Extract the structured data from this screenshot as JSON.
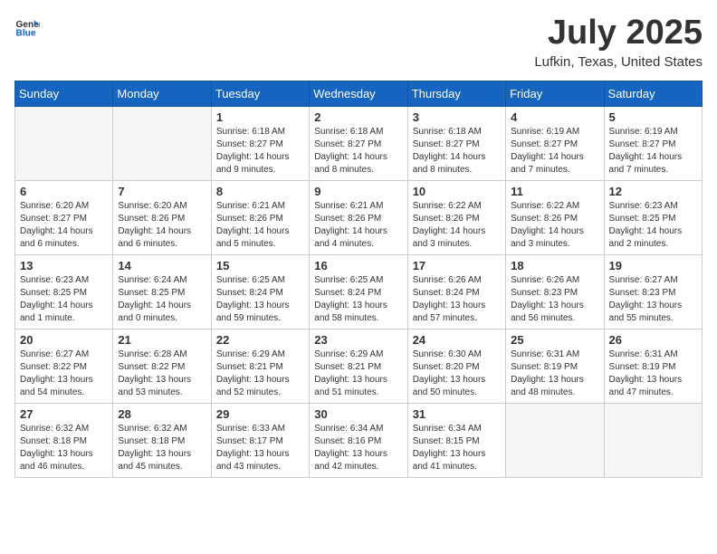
{
  "header": {
    "logo_general": "General",
    "logo_blue": "Blue",
    "month_year": "July 2025",
    "location": "Lufkin, Texas, United States"
  },
  "weekdays": [
    "Sunday",
    "Monday",
    "Tuesday",
    "Wednesday",
    "Thursday",
    "Friday",
    "Saturday"
  ],
  "weeks": [
    [
      {
        "day": "",
        "info": ""
      },
      {
        "day": "",
        "info": ""
      },
      {
        "day": "1",
        "info": "Sunrise: 6:18 AM\nSunset: 8:27 PM\nDaylight: 14 hours\nand 9 minutes."
      },
      {
        "day": "2",
        "info": "Sunrise: 6:18 AM\nSunset: 8:27 PM\nDaylight: 14 hours\nand 8 minutes."
      },
      {
        "day": "3",
        "info": "Sunrise: 6:18 AM\nSunset: 8:27 PM\nDaylight: 14 hours\nand 8 minutes."
      },
      {
        "day": "4",
        "info": "Sunrise: 6:19 AM\nSunset: 8:27 PM\nDaylight: 14 hours\nand 7 minutes."
      },
      {
        "day": "5",
        "info": "Sunrise: 6:19 AM\nSunset: 8:27 PM\nDaylight: 14 hours\nand 7 minutes."
      }
    ],
    [
      {
        "day": "6",
        "info": "Sunrise: 6:20 AM\nSunset: 8:27 PM\nDaylight: 14 hours\nand 6 minutes."
      },
      {
        "day": "7",
        "info": "Sunrise: 6:20 AM\nSunset: 8:26 PM\nDaylight: 14 hours\nand 6 minutes."
      },
      {
        "day": "8",
        "info": "Sunrise: 6:21 AM\nSunset: 8:26 PM\nDaylight: 14 hours\nand 5 minutes."
      },
      {
        "day": "9",
        "info": "Sunrise: 6:21 AM\nSunset: 8:26 PM\nDaylight: 14 hours\nand 4 minutes."
      },
      {
        "day": "10",
        "info": "Sunrise: 6:22 AM\nSunset: 8:26 PM\nDaylight: 14 hours\nand 3 minutes."
      },
      {
        "day": "11",
        "info": "Sunrise: 6:22 AM\nSunset: 8:26 PM\nDaylight: 14 hours\nand 3 minutes."
      },
      {
        "day": "12",
        "info": "Sunrise: 6:23 AM\nSunset: 8:25 PM\nDaylight: 14 hours\nand 2 minutes."
      }
    ],
    [
      {
        "day": "13",
        "info": "Sunrise: 6:23 AM\nSunset: 8:25 PM\nDaylight: 14 hours\nand 1 minute."
      },
      {
        "day": "14",
        "info": "Sunrise: 6:24 AM\nSunset: 8:25 PM\nDaylight: 14 hours\nand 0 minutes."
      },
      {
        "day": "15",
        "info": "Sunrise: 6:25 AM\nSunset: 8:24 PM\nDaylight: 13 hours\nand 59 minutes."
      },
      {
        "day": "16",
        "info": "Sunrise: 6:25 AM\nSunset: 8:24 PM\nDaylight: 13 hours\nand 58 minutes."
      },
      {
        "day": "17",
        "info": "Sunrise: 6:26 AM\nSunset: 8:24 PM\nDaylight: 13 hours\nand 57 minutes."
      },
      {
        "day": "18",
        "info": "Sunrise: 6:26 AM\nSunset: 8:23 PM\nDaylight: 13 hours\nand 56 minutes."
      },
      {
        "day": "19",
        "info": "Sunrise: 6:27 AM\nSunset: 8:23 PM\nDaylight: 13 hours\nand 55 minutes."
      }
    ],
    [
      {
        "day": "20",
        "info": "Sunrise: 6:27 AM\nSunset: 8:22 PM\nDaylight: 13 hours\nand 54 minutes."
      },
      {
        "day": "21",
        "info": "Sunrise: 6:28 AM\nSunset: 8:22 PM\nDaylight: 13 hours\nand 53 minutes."
      },
      {
        "day": "22",
        "info": "Sunrise: 6:29 AM\nSunset: 8:21 PM\nDaylight: 13 hours\nand 52 minutes."
      },
      {
        "day": "23",
        "info": "Sunrise: 6:29 AM\nSunset: 8:21 PM\nDaylight: 13 hours\nand 51 minutes."
      },
      {
        "day": "24",
        "info": "Sunrise: 6:30 AM\nSunset: 8:20 PM\nDaylight: 13 hours\nand 50 minutes."
      },
      {
        "day": "25",
        "info": "Sunrise: 6:31 AM\nSunset: 8:19 PM\nDaylight: 13 hours\nand 48 minutes."
      },
      {
        "day": "26",
        "info": "Sunrise: 6:31 AM\nSunset: 8:19 PM\nDaylight: 13 hours\nand 47 minutes."
      }
    ],
    [
      {
        "day": "27",
        "info": "Sunrise: 6:32 AM\nSunset: 8:18 PM\nDaylight: 13 hours\nand 46 minutes."
      },
      {
        "day": "28",
        "info": "Sunrise: 6:32 AM\nSunset: 8:18 PM\nDaylight: 13 hours\nand 45 minutes."
      },
      {
        "day": "29",
        "info": "Sunrise: 6:33 AM\nSunset: 8:17 PM\nDaylight: 13 hours\nand 43 minutes."
      },
      {
        "day": "30",
        "info": "Sunrise: 6:34 AM\nSunset: 8:16 PM\nDaylight: 13 hours\nand 42 minutes."
      },
      {
        "day": "31",
        "info": "Sunrise: 6:34 AM\nSunset: 8:15 PM\nDaylight: 13 hours\nand 41 minutes."
      },
      {
        "day": "",
        "info": ""
      },
      {
        "day": "",
        "info": ""
      }
    ]
  ]
}
